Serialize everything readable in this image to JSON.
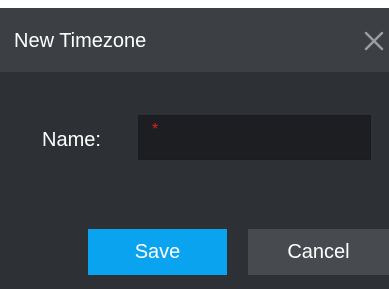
{
  "dialog": {
    "title": "New Timezone",
    "close_icon": "close-icon"
  },
  "form": {
    "name_label": "Name:",
    "name_required_mark": "*",
    "name_value": "",
    "name_placeholder": ""
  },
  "actions": {
    "save_label": "Save",
    "cancel_label": "Cancel"
  },
  "colors": {
    "titlebar_bg": "#3c3f43",
    "body_bg": "#2d3034",
    "input_bg": "#1c1e21",
    "required": "#e02020",
    "primary": "#0aa3f0",
    "secondary": "#474a4e"
  }
}
